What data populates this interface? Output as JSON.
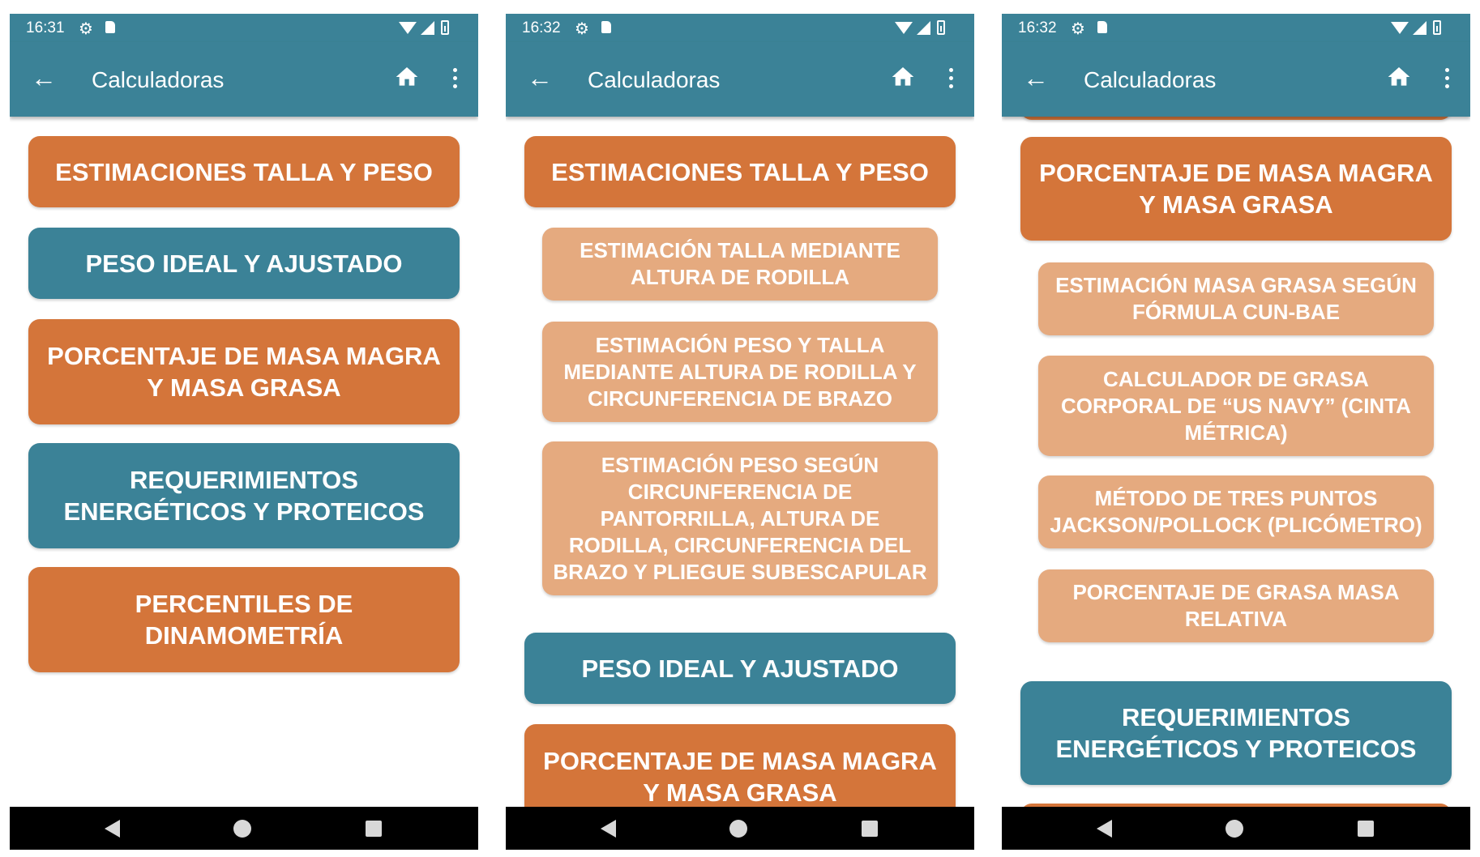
{
  "colors": {
    "primary": "#3b8297",
    "orange": "#d4753a",
    "light_orange": "#e5aa7f",
    "nav_bar": "#000000"
  },
  "screens": [
    {
      "status_time": "16:31",
      "app_title": "Calculadoras",
      "items": [
        "Estimaciones talla y peso",
        "Peso ideal y ajustado",
        "Porcentaje de masa magra y masa grasa",
        "Requerimientos energéticos y proteicos",
        "Percentiles de dinamometría"
      ]
    },
    {
      "status_time": "16:32",
      "app_title": "Calculadoras",
      "items": [
        "Estimaciones talla y peso",
        "Estimación talla mediante altura de rodilla",
        "Estimación peso y talla mediante altura de rodilla y circunferencia de brazo",
        "Estimación peso según circunferencia de pantorrilla, altura de rodilla, circunferencia del brazo y pliegue subescapular",
        "Peso ideal y ajustado",
        "Porcentaje de masa magra y masa grasa"
      ]
    },
    {
      "status_time": "16:32",
      "app_title": "Calculadoras",
      "items": [
        "Porcentaje de masa magra y masa grasa",
        "Estimación masa grasa según fórmula CUN-BAE",
        "Calculador de grasa corporal de “US Navy” (cinta métrica)",
        "Método de tres puntos Jackson/Pollock (plicómetro)",
        "Porcentaje de grasa masa relativa",
        "Requerimientos energéticos y proteicos"
      ]
    }
  ]
}
